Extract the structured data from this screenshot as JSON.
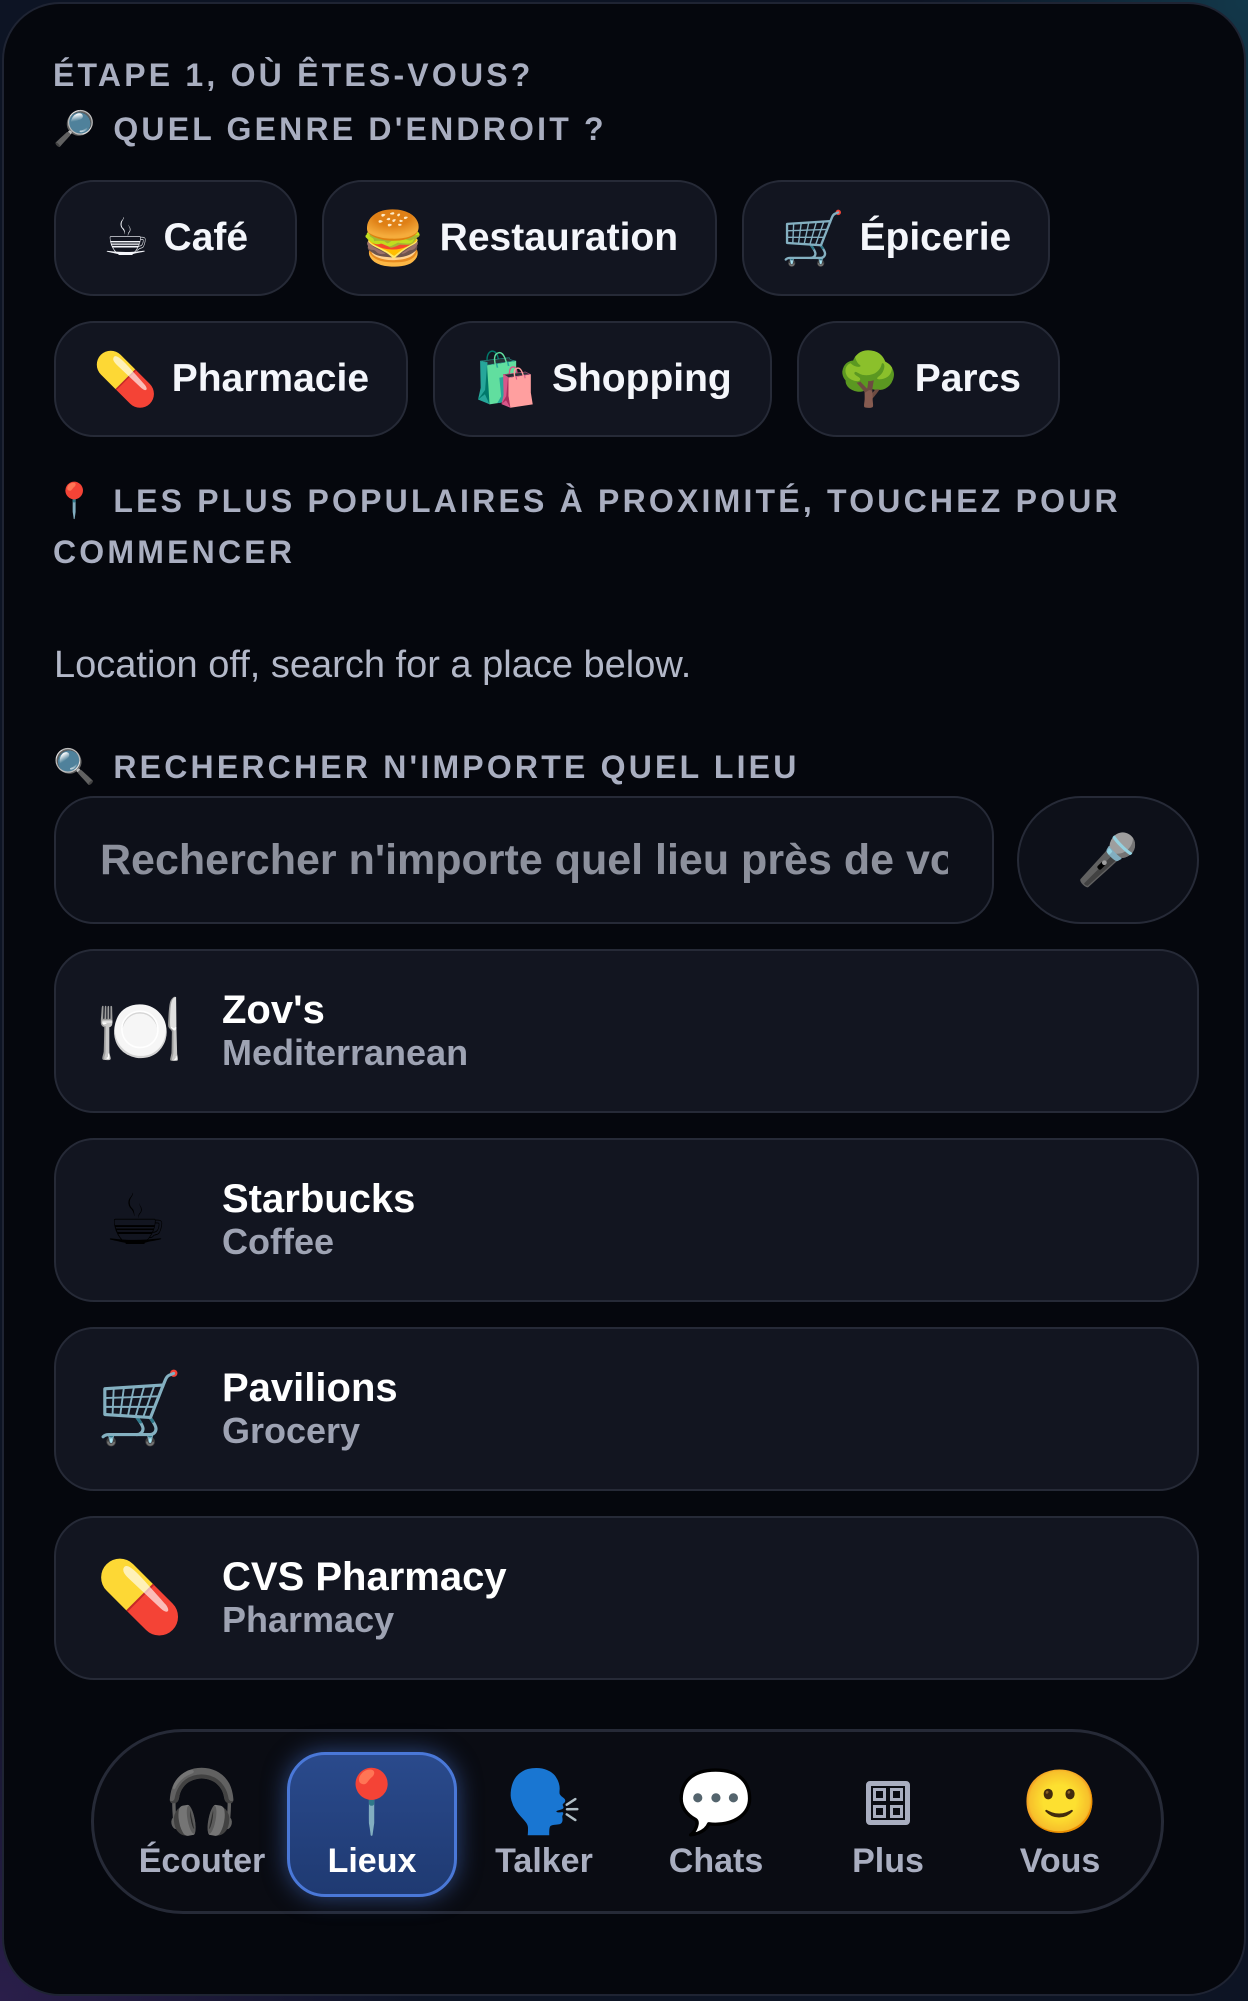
{
  "step": {
    "title": "ÉTAPE 1, OÙ ÊTES-VOUS?",
    "question_icon": "🔎",
    "question": "QUEL GENRE D'ENDROIT ?"
  },
  "categories": [
    {
      "emoji": "☕",
      "label": "Café"
    },
    {
      "emoji": "🍔",
      "label": "Restauration"
    },
    {
      "emoji": "🛒",
      "label": "Épicerie"
    },
    {
      "emoji": "💊",
      "label": "Pharmacie"
    },
    {
      "emoji": "🛍️",
      "label": "Shopping"
    },
    {
      "emoji": "🌳",
      "label": "Parcs"
    }
  ],
  "popular": {
    "icon": "📍",
    "title": "LES PLUS POPULAIRES À PROXIMITÉ, TOUCHEZ POUR COMMENCER",
    "status": "Location off, search for a place below."
  },
  "search": {
    "icon": "🔍",
    "title": "RECHERCHER N'IMPORTE QUEL LIEU",
    "placeholder": "Rechercher n'importe quel lieu près de vous",
    "value": "",
    "mic_icon": "🎤"
  },
  "places": [
    {
      "emoji": "🍽️",
      "name": "Zov's",
      "category": "Mediterranean"
    },
    {
      "emoji": "☕",
      "name": "Starbucks",
      "category": "Coffee"
    },
    {
      "emoji": "🛒",
      "name": "Pavilions",
      "category": "Grocery"
    },
    {
      "emoji": "💊",
      "name": "CVS Pharmacy",
      "category": "Pharmacy"
    }
  ],
  "nav": {
    "items": [
      {
        "emoji": "🎧",
        "label": "Écouter"
      },
      {
        "emoji": "📍",
        "label": "Lieux",
        "active": true
      },
      {
        "emoji": "🗣️",
        "label": "Talker"
      },
      {
        "emoji": "💬",
        "label": "Chats"
      },
      {
        "icon": "grid-icon",
        "label": "Plus"
      },
      {
        "emoji": "🙂",
        "label": "Vous"
      }
    ]
  },
  "colors": {
    "background": "#05070d",
    "card": "#121520",
    "border": "#262a37",
    "section_text": "#a9aec0",
    "active_tab": "#2a4a8c",
    "active_tab_border": "#4a78d8"
  }
}
